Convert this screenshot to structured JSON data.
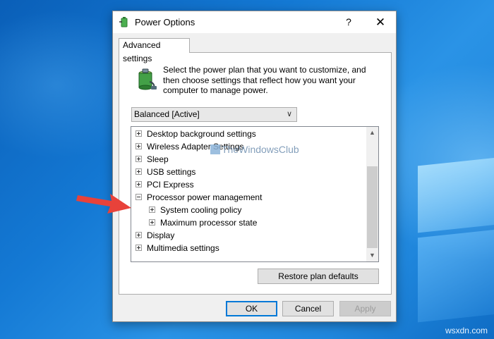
{
  "window": {
    "title": "Power Options",
    "help_label": "?",
    "close_label": "✕"
  },
  "tab": {
    "label": "Advanced settings"
  },
  "description": "Select the power plan that you want to customize, and then choose settings that reflect how you want your computer to manage power.",
  "plan_select": {
    "value": "Balanced [Active]"
  },
  "tree": {
    "items": [
      {
        "label": "Desktop background settings",
        "expanded": false,
        "level": 0
      },
      {
        "label": "Wireless Adapter Settings",
        "expanded": false,
        "level": 0
      },
      {
        "label": "Sleep",
        "expanded": false,
        "level": 0
      },
      {
        "label": "USB settings",
        "expanded": false,
        "level": 0
      },
      {
        "label": "PCI Express",
        "expanded": false,
        "level": 0
      },
      {
        "label": "Processor power management",
        "expanded": true,
        "level": 0
      },
      {
        "label": "System cooling policy",
        "expanded": false,
        "level": 1
      },
      {
        "label": "Maximum processor state",
        "expanded": false,
        "level": 1
      },
      {
        "label": "Display",
        "expanded": false,
        "level": 0
      },
      {
        "label": "Multimedia settings",
        "expanded": false,
        "level": 0
      }
    ]
  },
  "watermark": {
    "text": "TheWindowsClub"
  },
  "restore_button": {
    "label": "Restore plan defaults"
  },
  "buttons": {
    "ok": "OK",
    "cancel": "Cancel",
    "apply": "Apply"
  },
  "site_mark": {
    "text": "wsxdn.com"
  },
  "colors": {
    "arrow": "#e8423a",
    "accent": "#0078d7"
  }
}
